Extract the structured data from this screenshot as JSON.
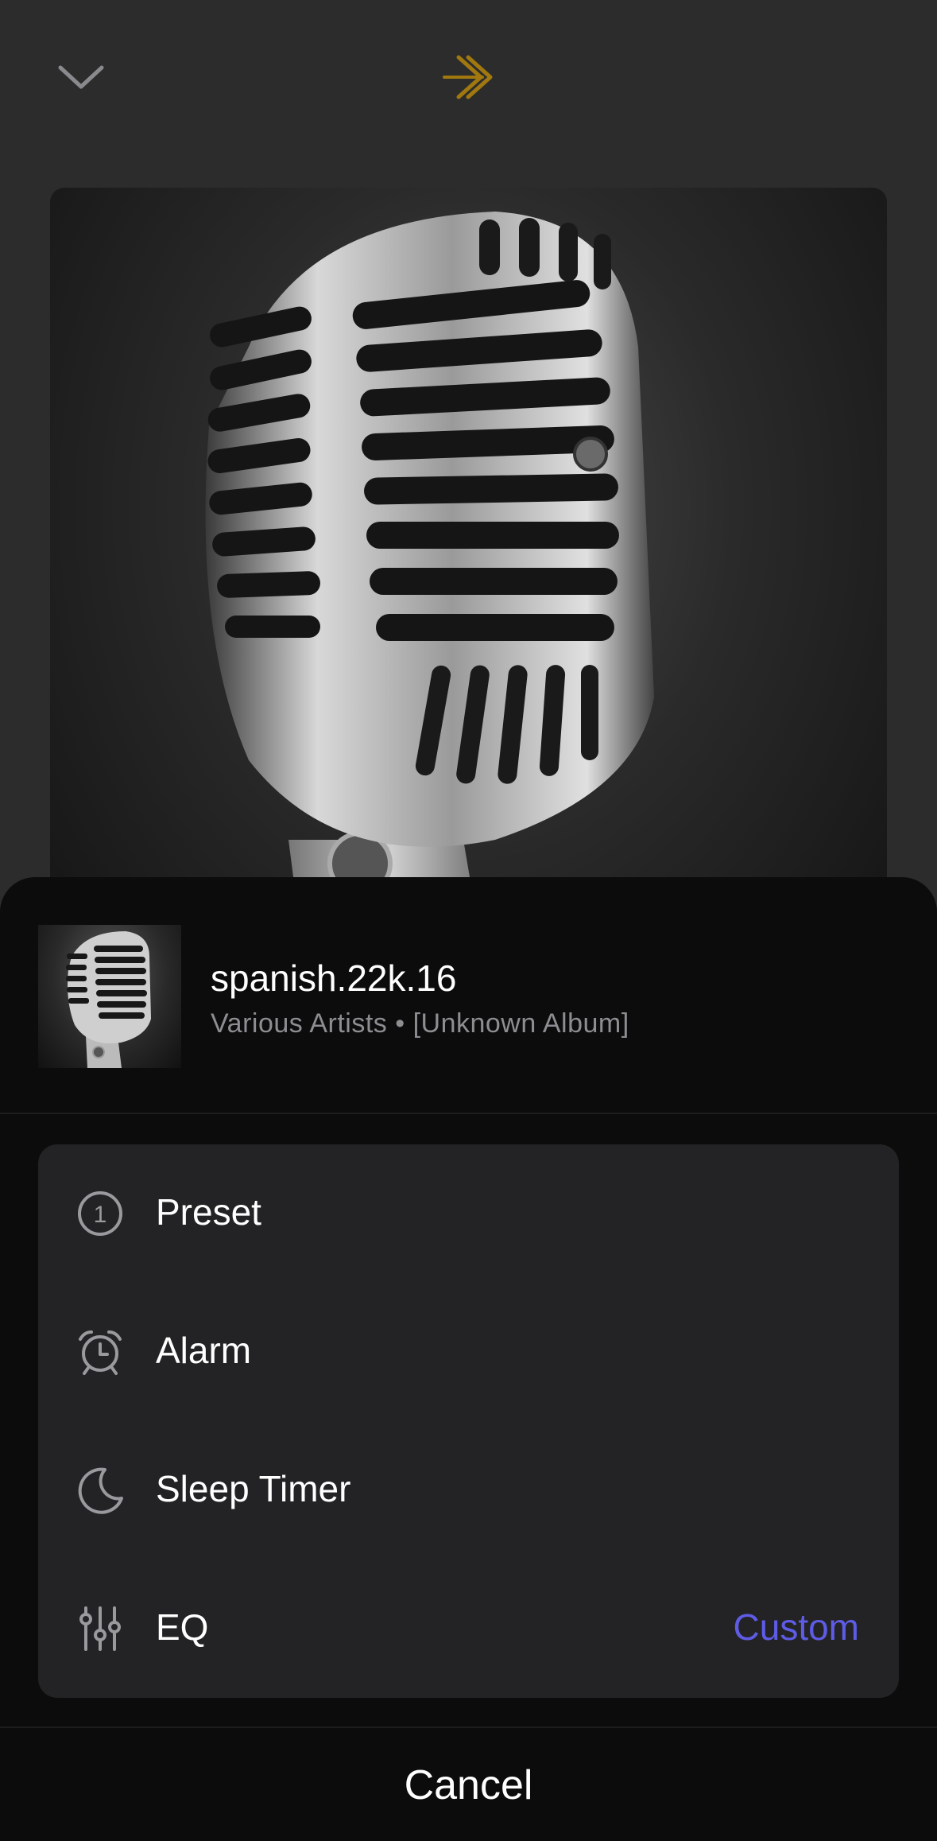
{
  "header": {
    "collapse_icon": "chevron-down-icon",
    "logo_icon": "double-arrow-logo",
    "logo_color": "#a0780f"
  },
  "artwork": {
    "subject": "microphone-artwork"
  },
  "track": {
    "title": "spanish.22k.16",
    "subtitle": "Various Artists • [Unknown Album]"
  },
  "menu": {
    "items": [
      {
        "label": "Preset",
        "icon": "preset-number-icon",
        "icon_text": "1",
        "value": ""
      },
      {
        "label": "Alarm",
        "icon": "alarm-clock-icon",
        "value": ""
      },
      {
        "label": "Sleep Timer",
        "icon": "moon-icon",
        "value": ""
      },
      {
        "label": "EQ",
        "icon": "equalizer-sliders-icon",
        "value": "Custom"
      }
    ],
    "accent_color": "#5e5ce6"
  },
  "cancel": {
    "label": "Cancel"
  }
}
